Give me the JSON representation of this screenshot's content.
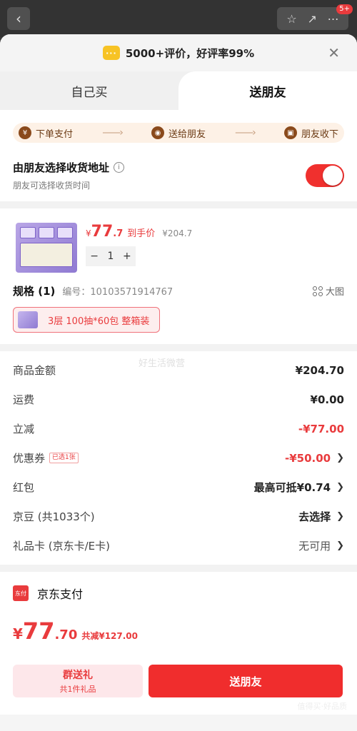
{
  "topbar": {
    "badge": "5+"
  },
  "rating": {
    "text": "5000+评价，好评率99%"
  },
  "tabs": [
    {
      "label": "自己买"
    },
    {
      "label": "送朋友"
    }
  ],
  "steps": [
    {
      "label": "下单支付",
      "icon": "yen-icon"
    },
    {
      "label": "送给朋友",
      "icon": "chat-icon"
    },
    {
      "label": "朋友收下",
      "icon": "gift-icon"
    }
  ],
  "address": {
    "title": "由朋友选择收货地址",
    "subtitle": "朋友可选择收货时间",
    "toggle_on": true
  },
  "product": {
    "price_symbol": "¥",
    "price_int": "77",
    "price_dec": ".7",
    "price_tag": "到手价",
    "original_price": "¥204.7",
    "quantity": "1",
    "minus": "−",
    "plus": "+"
  },
  "spec": {
    "title": "规格 (1)",
    "code": "编号：10103571914767",
    "big_image": "大图",
    "option": "3层 100抽*60包 整箱装"
  },
  "watermark": "好生活微营",
  "fees": [
    {
      "label": "商品金额",
      "value": "¥204.70"
    },
    {
      "label": "运费",
      "value": "¥0.00"
    },
    {
      "label": "立减",
      "value": "-¥77.00"
    },
    {
      "label": "优惠券",
      "tag": "已选1张",
      "value": "-¥50.00"
    },
    {
      "label": "红包",
      "value": "最高可抵¥0.74"
    },
    {
      "label": "京豆 (共1033个)",
      "value": "去选择"
    },
    {
      "label": "礼品卡 (京东卡/E卡)",
      "value": "无可用"
    }
  ],
  "payment": {
    "icon_text": "东付",
    "method": "京东支付"
  },
  "total": {
    "symbol": "¥",
    "int": "77",
    "dec": ".70",
    "saved": "共减¥127.00"
  },
  "buttons": {
    "group_gift": "群送礼",
    "group_gift_sub": "共1件礼品",
    "send": "送朋友"
  },
  "footer_watermark": "值得买·好品质",
  "colors": {
    "accent": "#e93b3d",
    "steps_bg": "#fdf1e6"
  }
}
